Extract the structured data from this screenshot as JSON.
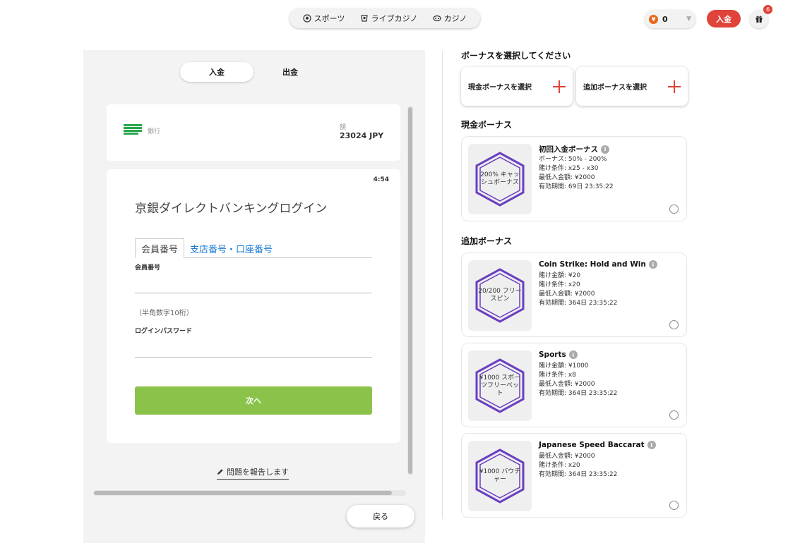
{
  "nav": {
    "items": [
      {
        "label": "スポーツ",
        "icon": "soccer-ball-icon"
      },
      {
        "label": "ライブカジノ",
        "icon": "live-casino-icon"
      },
      {
        "label": "カジノ",
        "icon": "casino-icon"
      }
    ],
    "coin_symbol": "¥",
    "balance": "0",
    "deposit_label": "入金",
    "gift_count": "6"
  },
  "left": {
    "tabs": [
      "入金",
      "出金"
    ],
    "active_tab": "入金",
    "bank_label": "銀行",
    "amount_label": "額",
    "amount_value": "23024 JPY",
    "timer": "4:54",
    "login_title": "京銀ダイレクトバンキングログイン",
    "login_tabs": [
      "会員番号",
      "支店番号・口座番号"
    ],
    "member_label": "会員番号",
    "member_hint": "（半角数字10桁）",
    "password_label": "ログインパスワード",
    "next_label": "次へ",
    "report_label": "問題を報告します",
    "back_label": "戻る"
  },
  "right": {
    "select_title": "ボーナスを選択してください",
    "select_cash_label": "現金ボーナスを選択",
    "select_extra_label": "追加ボーナスを選択",
    "cash_section_title": "現金ボーナス",
    "extra_section_title": "追加ボーナス",
    "accent_color": "#6a3fc0",
    "cash_bonuses": [
      {
        "badge": "200% キャッシュボーナス",
        "name": "初回入金ボーナス",
        "lines": [
          "ボーナス: 50% - 200%",
          "賭け条件: x25 - x30",
          "最低入金額: ¥2000",
          "有効期間: 69日  23:35:22"
        ]
      }
    ],
    "extra_bonuses": [
      {
        "badge": "20/200 フリースピン",
        "name": "Coin Strike: Hold and Win",
        "lines": [
          "賭け金額: ¥20",
          "賭け条件: x20",
          "最低入金額: ¥2000",
          "有効期間: 364日  23:35:22"
        ]
      },
      {
        "badge": "¥1000 スポーツフリーベット",
        "name": "Sports",
        "lines": [
          "賭け金額: ¥1000",
          "賭け条件: x8",
          "最低入金額: ¥2000",
          "有効期間: 364日  23:35:22"
        ]
      },
      {
        "badge": "¥1000 バウチャー",
        "name": "Japanese Speed Baccarat",
        "lines": [
          "最低入金額: ¥2000",
          "賭け条件: x20",
          "有効期間: 364日  23:35:22"
        ]
      }
    ]
  }
}
